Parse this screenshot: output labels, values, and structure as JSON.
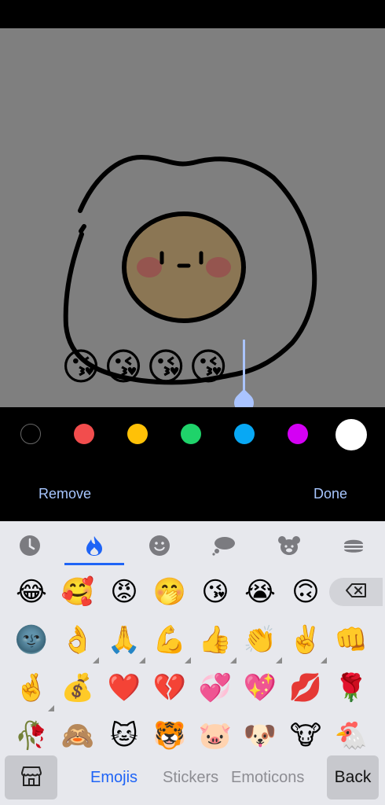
{
  "canvas": {
    "inserted_text": "😘😘😘😘"
  },
  "palette": {
    "colors": [
      "#000000",
      "#f24d4d",
      "#ffc107",
      "#1fd36a",
      "#08a8f4",
      "#d400f4",
      "#ffffff"
    ]
  },
  "actions": {
    "remove_label": "Remove",
    "done_label": "Done"
  },
  "keyboard": {
    "categories": [
      "recent-icon",
      "trending-icon",
      "smiley-icon",
      "thought-bubble-icon",
      "animal-icon",
      "food-icon"
    ],
    "rows": [
      [
        "😂",
        "🥰",
        "😡",
        "🤭",
        "😘",
        "😭",
        "🙃"
      ],
      [
        "🌚",
        "👌",
        "🙏",
        "💪",
        "👍",
        "👏",
        "✌️",
        "👊"
      ],
      [
        "🤞",
        "💰",
        "❤️",
        "💔",
        "💞",
        "💖",
        "💋",
        "🌹"
      ],
      [
        "🥀",
        "🙈",
        "🐱",
        "🐯",
        "🐷",
        "🐶",
        "🐮",
        "🐔"
      ]
    ],
    "tabs": {
      "emojis": "Emojis",
      "stickers": "Stickers",
      "emoticons": "Emoticons"
    },
    "back_label": "Back"
  }
}
